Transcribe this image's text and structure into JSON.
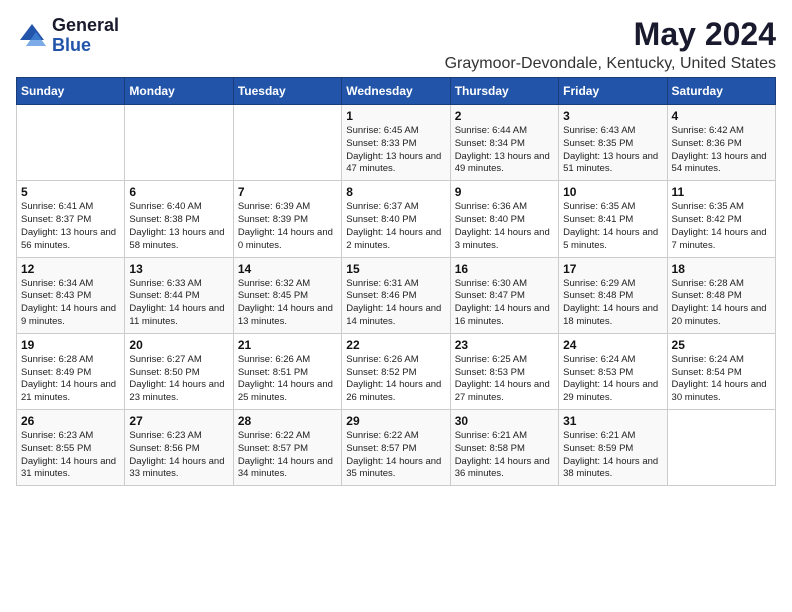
{
  "logo": {
    "general": "General",
    "blue": "Blue"
  },
  "title": "May 2024",
  "subtitle": "Graymoor-Devondale, Kentucky, United States",
  "days_of_week": [
    "Sunday",
    "Monday",
    "Tuesday",
    "Wednesday",
    "Thursday",
    "Friday",
    "Saturday"
  ],
  "weeks": [
    [
      {
        "day": "",
        "info": ""
      },
      {
        "day": "",
        "info": ""
      },
      {
        "day": "",
        "info": ""
      },
      {
        "day": "1",
        "info": "Sunrise: 6:45 AM\nSunset: 8:33 PM\nDaylight: 13 hours and 47 minutes."
      },
      {
        "day": "2",
        "info": "Sunrise: 6:44 AM\nSunset: 8:34 PM\nDaylight: 13 hours and 49 minutes."
      },
      {
        "day": "3",
        "info": "Sunrise: 6:43 AM\nSunset: 8:35 PM\nDaylight: 13 hours and 51 minutes."
      },
      {
        "day": "4",
        "info": "Sunrise: 6:42 AM\nSunset: 8:36 PM\nDaylight: 13 hours and 54 minutes."
      }
    ],
    [
      {
        "day": "5",
        "info": "Sunrise: 6:41 AM\nSunset: 8:37 PM\nDaylight: 13 hours and 56 minutes."
      },
      {
        "day": "6",
        "info": "Sunrise: 6:40 AM\nSunset: 8:38 PM\nDaylight: 13 hours and 58 minutes."
      },
      {
        "day": "7",
        "info": "Sunrise: 6:39 AM\nSunset: 8:39 PM\nDaylight: 14 hours and 0 minutes."
      },
      {
        "day": "8",
        "info": "Sunrise: 6:37 AM\nSunset: 8:40 PM\nDaylight: 14 hours and 2 minutes."
      },
      {
        "day": "9",
        "info": "Sunrise: 6:36 AM\nSunset: 8:40 PM\nDaylight: 14 hours and 3 minutes."
      },
      {
        "day": "10",
        "info": "Sunrise: 6:35 AM\nSunset: 8:41 PM\nDaylight: 14 hours and 5 minutes."
      },
      {
        "day": "11",
        "info": "Sunrise: 6:35 AM\nSunset: 8:42 PM\nDaylight: 14 hours and 7 minutes."
      }
    ],
    [
      {
        "day": "12",
        "info": "Sunrise: 6:34 AM\nSunset: 8:43 PM\nDaylight: 14 hours and 9 minutes."
      },
      {
        "day": "13",
        "info": "Sunrise: 6:33 AM\nSunset: 8:44 PM\nDaylight: 14 hours and 11 minutes."
      },
      {
        "day": "14",
        "info": "Sunrise: 6:32 AM\nSunset: 8:45 PM\nDaylight: 14 hours and 13 minutes."
      },
      {
        "day": "15",
        "info": "Sunrise: 6:31 AM\nSunset: 8:46 PM\nDaylight: 14 hours and 14 minutes."
      },
      {
        "day": "16",
        "info": "Sunrise: 6:30 AM\nSunset: 8:47 PM\nDaylight: 14 hours and 16 minutes."
      },
      {
        "day": "17",
        "info": "Sunrise: 6:29 AM\nSunset: 8:48 PM\nDaylight: 14 hours and 18 minutes."
      },
      {
        "day": "18",
        "info": "Sunrise: 6:28 AM\nSunset: 8:48 PM\nDaylight: 14 hours and 20 minutes."
      }
    ],
    [
      {
        "day": "19",
        "info": "Sunrise: 6:28 AM\nSunset: 8:49 PM\nDaylight: 14 hours and 21 minutes."
      },
      {
        "day": "20",
        "info": "Sunrise: 6:27 AM\nSunset: 8:50 PM\nDaylight: 14 hours and 23 minutes."
      },
      {
        "day": "21",
        "info": "Sunrise: 6:26 AM\nSunset: 8:51 PM\nDaylight: 14 hours and 25 minutes."
      },
      {
        "day": "22",
        "info": "Sunrise: 6:26 AM\nSunset: 8:52 PM\nDaylight: 14 hours and 26 minutes."
      },
      {
        "day": "23",
        "info": "Sunrise: 6:25 AM\nSunset: 8:53 PM\nDaylight: 14 hours and 27 minutes."
      },
      {
        "day": "24",
        "info": "Sunrise: 6:24 AM\nSunset: 8:53 PM\nDaylight: 14 hours and 29 minutes."
      },
      {
        "day": "25",
        "info": "Sunrise: 6:24 AM\nSunset: 8:54 PM\nDaylight: 14 hours and 30 minutes."
      }
    ],
    [
      {
        "day": "26",
        "info": "Sunrise: 6:23 AM\nSunset: 8:55 PM\nDaylight: 14 hours and 31 minutes."
      },
      {
        "day": "27",
        "info": "Sunrise: 6:23 AM\nSunset: 8:56 PM\nDaylight: 14 hours and 33 minutes."
      },
      {
        "day": "28",
        "info": "Sunrise: 6:22 AM\nSunset: 8:57 PM\nDaylight: 14 hours and 34 minutes."
      },
      {
        "day": "29",
        "info": "Sunrise: 6:22 AM\nSunset: 8:57 PM\nDaylight: 14 hours and 35 minutes."
      },
      {
        "day": "30",
        "info": "Sunrise: 6:21 AM\nSunset: 8:58 PM\nDaylight: 14 hours and 36 minutes."
      },
      {
        "day": "31",
        "info": "Sunrise: 6:21 AM\nSunset: 8:59 PM\nDaylight: 14 hours and 38 minutes."
      },
      {
        "day": "",
        "info": ""
      }
    ]
  ]
}
